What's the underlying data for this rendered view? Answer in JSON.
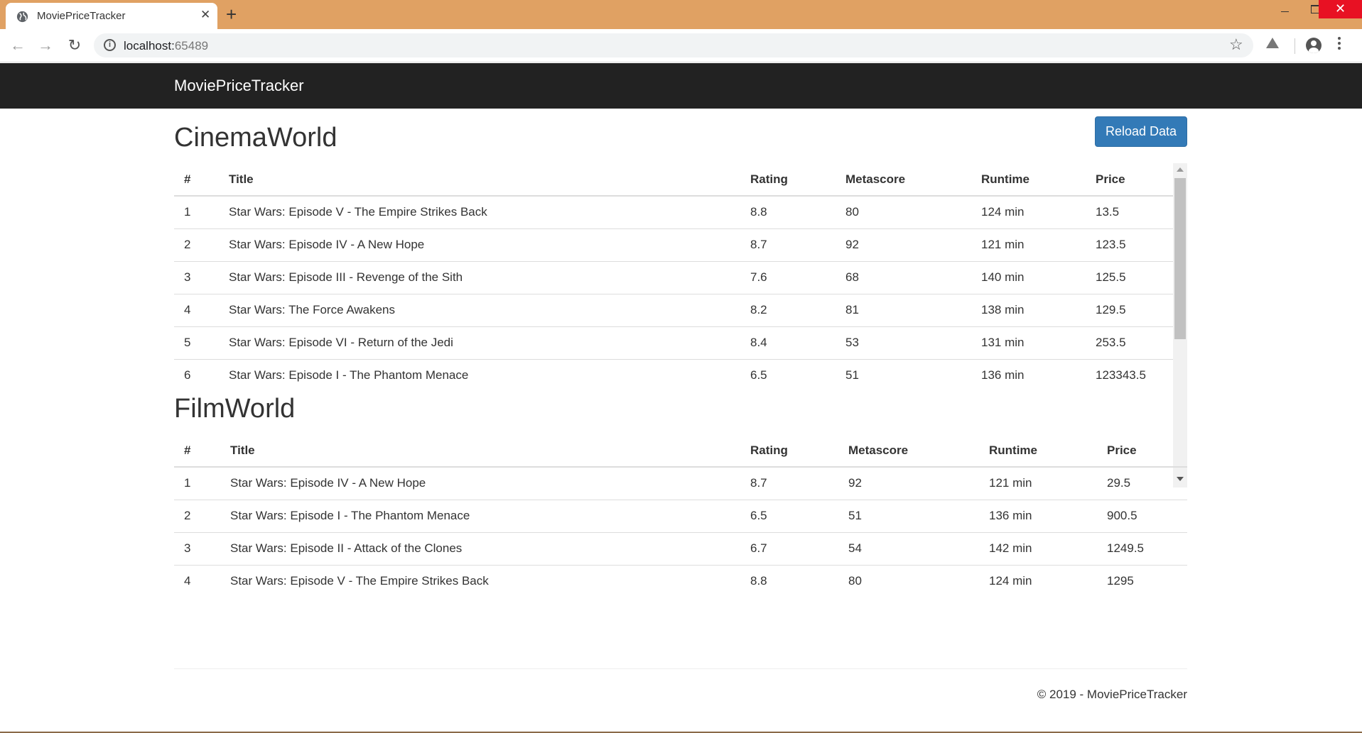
{
  "browser": {
    "tab_title": "MoviePriceTracker",
    "tab_close": "✕",
    "new_tab": "+",
    "url_host": "localhost:",
    "url_port": "65489",
    "back_icon": "←",
    "forward_icon": "→",
    "reload_icon": "↻",
    "star_icon": "☆",
    "close_window": "✕"
  },
  "navbar": {
    "brand": "MoviePriceTracker"
  },
  "cinemaworld": {
    "title": "CinemaWorld",
    "reload_label": "Reload Data",
    "headers": [
      "#",
      "Title",
      "Rating",
      "Metascore",
      "Runtime",
      "Price"
    ],
    "rows": [
      [
        "1",
        "Star Wars: Episode V - The Empire Strikes Back",
        "8.8",
        "80",
        "124 min",
        "13.5"
      ],
      [
        "2",
        "Star Wars: Episode IV - A New Hope",
        "8.7",
        "92",
        "121 min",
        "123.5"
      ],
      [
        "3",
        "Star Wars: Episode III - Revenge of the Sith",
        "7.6",
        "68",
        "140 min",
        "125.5"
      ],
      [
        "4",
        "Star Wars: The Force Awakens",
        "8.2",
        "81",
        "138 min",
        "129.5"
      ],
      [
        "5",
        "Star Wars: Episode VI - Return of the Jedi",
        "8.4",
        "53",
        "131 min",
        "253.5"
      ],
      [
        "6",
        "Star Wars: Episode I - The Phantom Menace",
        "6.5",
        "51",
        "136 min",
        "123343.5"
      ]
    ]
  },
  "filmworld": {
    "title": "FilmWorld",
    "headers": [
      "#",
      "Title",
      "Rating",
      "Metascore",
      "Runtime",
      "Price"
    ],
    "rows": [
      [
        "1",
        "Star Wars: Episode IV - A New Hope",
        "8.7",
        "92",
        "121 min",
        "29.5"
      ],
      [
        "2",
        "Star Wars: Episode I - The Phantom Menace",
        "6.5",
        "51",
        "136 min",
        "900.5"
      ],
      [
        "3",
        "Star Wars: Episode II - Attack of the Clones",
        "6.7",
        "54",
        "142 min",
        "1249.5"
      ],
      [
        "4",
        "Star Wars: Episode V - The Empire Strikes Back",
        "8.8",
        "80",
        "124 min",
        "1295"
      ]
    ]
  },
  "footer": {
    "text": "© 2019 - MoviePriceTracker"
  },
  "colors": {
    "titlebar": "#e0a163",
    "navbar": "#222222",
    "primary": "#337ab7",
    "close": "#e81123"
  }
}
